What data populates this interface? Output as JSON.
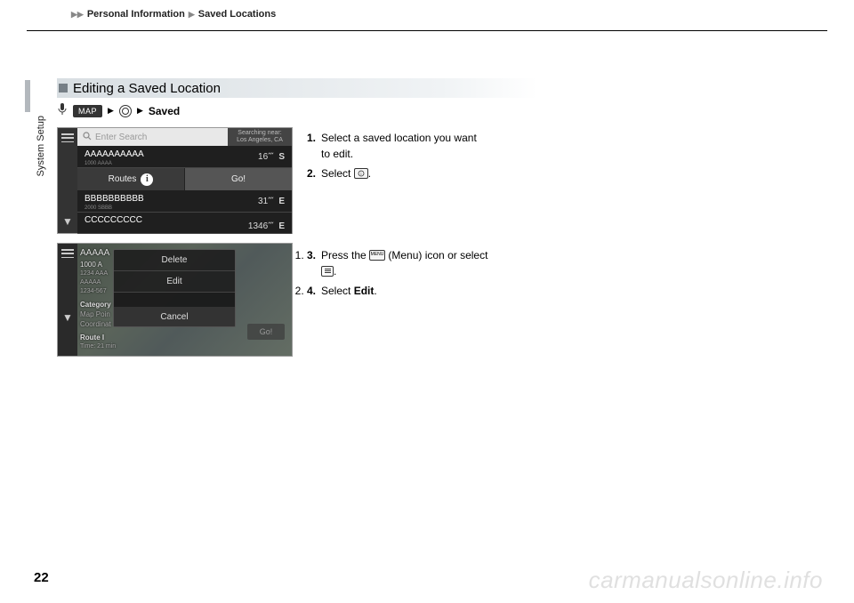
{
  "breadcrumb": {
    "a": "Personal Information",
    "b": "Saved Locations"
  },
  "side_section": "System Setup",
  "page_number": "22",
  "watermark": "carmanualsonline.info",
  "heading": "Editing a Saved Location",
  "path": {
    "map": "MAP",
    "saved": "Saved"
  },
  "screen1": {
    "search_placeholder": "Enter Search",
    "searching_label": "Searching near:",
    "searching_location": "Los Angeles, CA",
    "rows": [
      {
        "name": "AAAAAAAAAA",
        "sub": "1000 AAAA",
        "dist": "16",
        "dir": "S"
      },
      {
        "name": "BBBBBBBBBB",
        "sub": "2000 SBBB",
        "dist": "31",
        "dir": "E"
      },
      {
        "name": "CCCCCCCCC",
        "sub": "",
        "dist": "1346",
        "dir": "E"
      }
    ],
    "routes_label": "Routes",
    "go_label": "Go!"
  },
  "screen2": {
    "info": {
      "name": "AAAAA",
      "addr1": "1000 A",
      "addr2": "1234 AAA",
      "addr3": "AAAAA",
      "addr4": "1234-567",
      "cat_label": "Category",
      "cat_val": "Map Poin",
      "coord": "Coordinat",
      "route": "Route I",
      "time": "Time: 21 min"
    },
    "dialog": {
      "delete": "Delete",
      "edit": "Edit",
      "cancel": "Cancel"
    },
    "go": "Go!"
  },
  "instructions1": {
    "s1a": "Select a saved location you want",
    "s1b": "to edit.",
    "s2a": "Select ",
    "s2b": "."
  },
  "instructions2": {
    "s3a": "Press the ",
    "s3b": " (Menu) icon or select",
    "s3c": ".",
    "s4a": "Select ",
    "s4b": "Edit",
    "s4c": "."
  },
  "icon_labels": {
    "menu_small": "MENU"
  }
}
